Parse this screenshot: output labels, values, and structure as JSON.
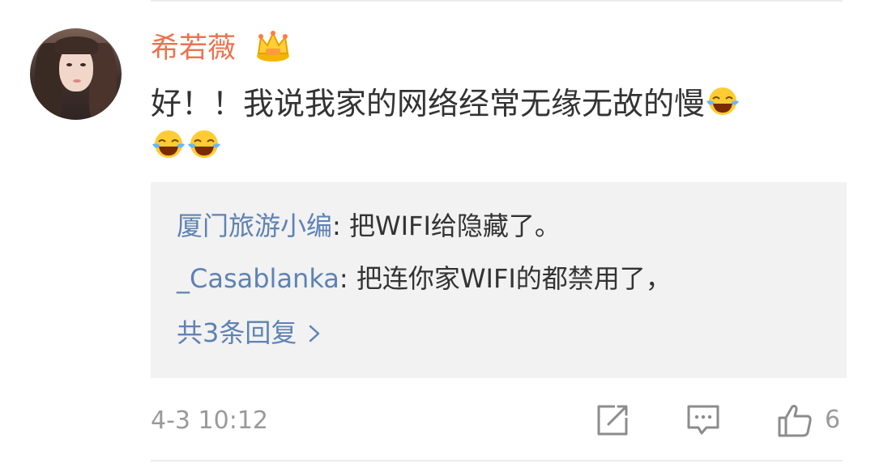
{
  "comment": {
    "username": "希若薇",
    "text": "好！！我说我家的网络经常无缘无故的慢",
    "emojis": [
      "laugh-cry",
      "laugh-cry",
      "laugh-cry"
    ],
    "timestamp": "4-3 10:12",
    "like_count": "6"
  },
  "replies": [
    {
      "name": "厦门旅游小编",
      "text": ": 把WIFI给隐藏了。"
    },
    {
      "name": "_Casablanka",
      "text": ": 把连你家WIFI的都禁用了，"
    }
  ],
  "more_replies_label": "共3条回复",
  "colors": {
    "username": "#eb7350",
    "link": "#5e82b4",
    "muted": "#9a9a9a",
    "reply_bg": "#f2f2f2"
  },
  "icons": [
    "crown-icon",
    "laugh-cry-emoji-icon",
    "chevron-right-icon",
    "share-icon",
    "comment-icon",
    "like-icon"
  ]
}
